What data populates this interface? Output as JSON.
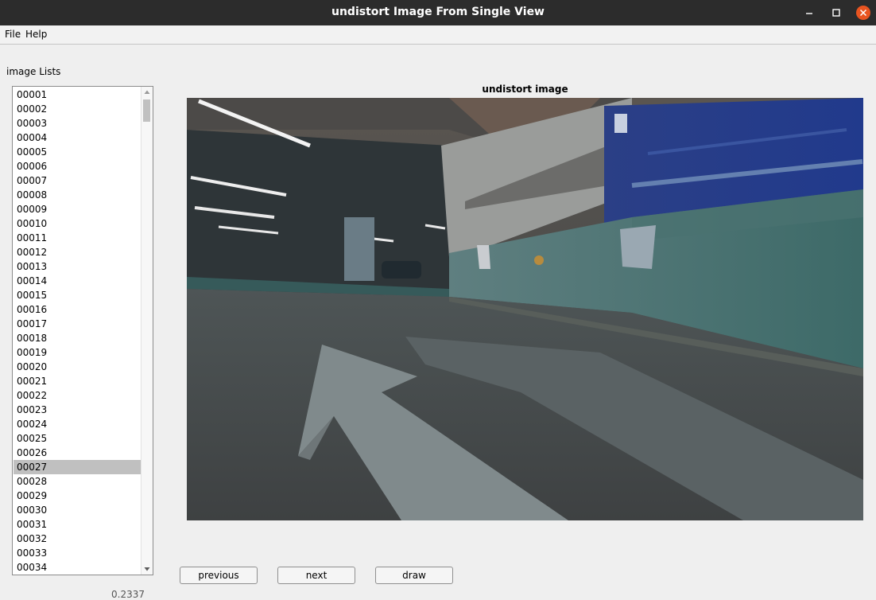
{
  "window": {
    "title": "undistort Image From Single View"
  },
  "menu": {
    "file": "File",
    "help": "Help"
  },
  "list": {
    "label": "image  Lists",
    "selected": "00027",
    "items": [
      "00001",
      "00002",
      "00003",
      "00004",
      "00005",
      "00006",
      "00007",
      "00008",
      "00009",
      "00010",
      "00011",
      "00012",
      "00013",
      "00014",
      "00015",
      "00016",
      "00017",
      "00018",
      "00019",
      "00020",
      "00021",
      "00022",
      "00023",
      "00024",
      "00025",
      "00026",
      "00027",
      "00028",
      "00029",
      "00030",
      "00031",
      "00032",
      "00033",
      "00034"
    ]
  },
  "panel": {
    "title": "undistort image"
  },
  "buttons": {
    "previous": "previous",
    "next": "next",
    "draw": "draw"
  },
  "footer": {
    "clipped_text": "0.2337"
  },
  "icons": {
    "minimize": "minimize-icon",
    "maximize": "maximize-icon",
    "close": "close-icon",
    "scroll_up": "triangle-up-icon",
    "scroll_down": "triangle-down-icon"
  },
  "colors": {
    "titlebar": "#2c2c2c",
    "close_button": "#e95420",
    "selection": "#c0c0c0"
  }
}
